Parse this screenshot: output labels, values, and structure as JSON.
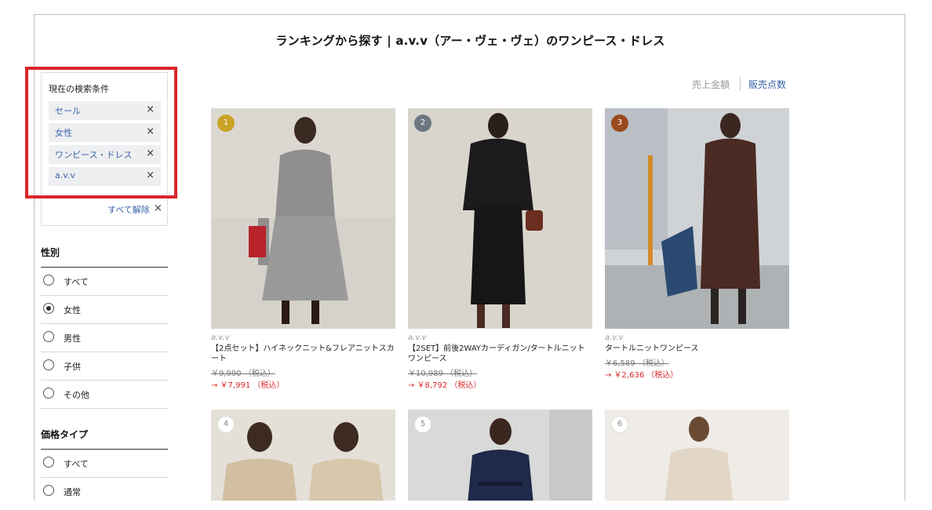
{
  "page": {
    "title": "ランキングから探す | a.v.v（アー・ヴェ・ヴェ）のワンピース・ドレス"
  },
  "conditions": {
    "title": "現在の検索条件",
    "chips": [
      "セール",
      "女性",
      "ワンピース・ドレス",
      "a.v.v"
    ],
    "remove_icon": "×",
    "clear_all": "すべて解除"
  },
  "filters": {
    "gender": {
      "title": "性別",
      "options": [
        "すべて",
        "女性",
        "男性",
        "子供",
        "その他"
      ],
      "selected": "女性"
    },
    "price_type": {
      "title": "価格タイプ",
      "options": [
        "すべて",
        "通常"
      ]
    }
  },
  "sort": {
    "option_a": "売上金額",
    "option_b": "販売点数"
  },
  "products": [
    {
      "rank": "1",
      "brand": "a.v.v",
      "name": "【2点セット】ハイネックニット&フレアニットスカート",
      "old_price": "￥9,990 （税込）",
      "new_price": "→ ￥7,991 （税込）",
      "rank_color": "#c9a227"
    },
    {
      "rank": "2",
      "brand": "a.v.v",
      "name": "【2SET】前後2WAYカーディガン/タートルニットワンピース",
      "old_price": "￥10,989 （税込）",
      "new_price": "→ ￥8,792 （税込）",
      "rank_color": "#6b7780"
    },
    {
      "rank": "3",
      "brand": "a.v.v",
      "name": "タートルニットワンピース",
      "old_price": "￥6,589 （税込）",
      "new_price": "→ ￥2,636 （税込）",
      "rank_color": "#9a4a1e"
    },
    {
      "rank": "4"
    },
    {
      "rank": "5"
    },
    {
      "rank": "6"
    }
  ],
  "colors": {
    "accent_link": "#3a64a8",
    "sale_price": "#d9262a",
    "highlight_border": "#d9262a"
  }
}
